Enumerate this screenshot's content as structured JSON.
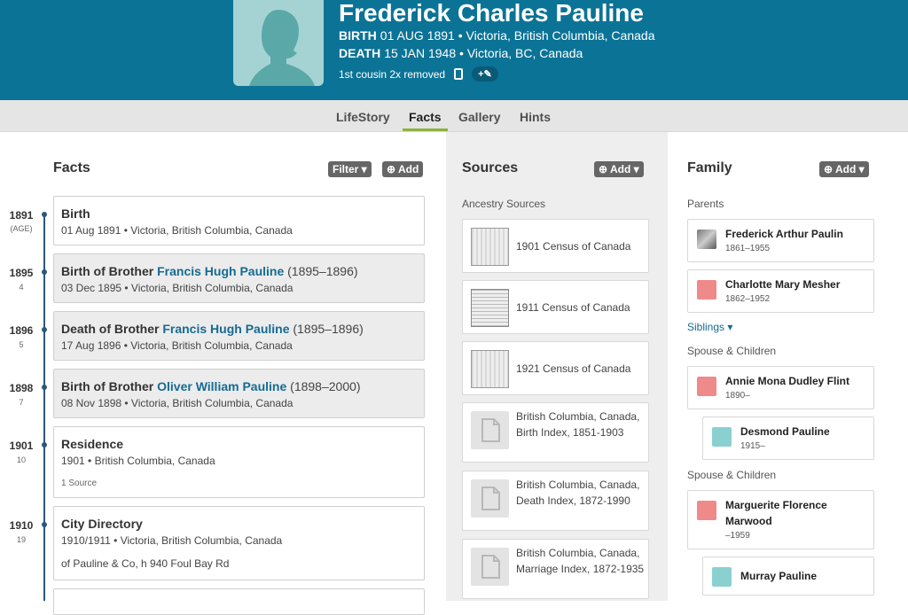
{
  "person": {
    "name": "Frederick Charles Pauline",
    "birth_label": "BIRTH",
    "birth": "01 AUG 1891 • Victoria, British Columbia, Canada",
    "death_label": "DEATH",
    "death": "15 JAN 1948 • Victoria, BC, Canada",
    "relation": "1st cousin 2x removed",
    "tag_button": "+✎"
  },
  "nav": {
    "tabs": [
      "LifeStory",
      "Facts",
      "Gallery",
      "Hints"
    ],
    "active": "Facts"
  },
  "facts": {
    "heading": "Facts",
    "filter_label": "Filter ▾",
    "add_label": "⊕ Add",
    "items": [
      {
        "year": "1891",
        "age": "(AGE)",
        "title": "Birth",
        "link": "",
        "range": "",
        "detail": "01 Aug 1891 • Victoria, British Columbia, Canada"
      },
      {
        "year": "1895",
        "age": "4",
        "title": "Birth of Brother ",
        "link": "Francis Hugh Pauline",
        "range": " (1895–1896)",
        "detail": "03 Dec 1895 • Victoria, British Columbia, Canada"
      },
      {
        "year": "1896",
        "age": "5",
        "title": "Death of Brother ",
        "link": "Francis Hugh Pauline",
        "range": " (1895–1896)",
        "detail": "17 Aug 1896 • Victoria, British Columbia, Canada"
      },
      {
        "year": "1898",
        "age": "7",
        "title": "Birth of Brother ",
        "link": "Oliver William Pauline",
        "range": " (1898–2000)",
        "detail": "08 Nov 1898 • Victoria, British Columbia, Canada"
      },
      {
        "year": "1901",
        "age": "10",
        "title": "Residence",
        "link": "",
        "range": "",
        "detail": "1901 • British Columbia, Canada",
        "extra": "1 Source"
      },
      {
        "year": "1910",
        "age": "19",
        "title": "City Directory",
        "link": "",
        "range": "",
        "detail": "1910/1911 • Victoria, British Columbia, Canada",
        "extra": "of Pauline & Co, h 940 Foul Bay Rd"
      }
    ]
  },
  "sources": {
    "heading": "Sources",
    "add_label": "⊕ Add ▾",
    "subheading": "Ancestry Sources",
    "items": [
      "1901 Census of Canada",
      "1911 Census of Canada",
      "1921 Census of Canada",
      "British Columbia, Canada, Birth Index, 1851-1903",
      "British Columbia, Canada, Death Index, 1872-1990",
      "British Columbia, Canada, Marriage Index, 1872-1935"
    ]
  },
  "family": {
    "heading": "Family",
    "add_label": "⊕ Add ▾",
    "parents_label": "Parents",
    "siblings_label": "Siblings ▾",
    "spouse_label_1": "Spouse & Children",
    "spouse_label_2": "Spouse & Children",
    "parents": [
      {
        "name": "Frederick Arthur Paulin",
        "years": "1861–1955"
      },
      {
        "name": "Charlotte Mary Mesher",
        "years": "1862–1952"
      }
    ],
    "spouse1": {
      "name": "Annie Mona Dudley Flint",
      "years": "1890–"
    },
    "child1": {
      "name": "Desmond Pauline",
      "years": "1915–"
    },
    "spouse2": {
      "name": "Marguerite Florence Marwood",
      "years": "–1959"
    },
    "child2": {
      "name": "Murray Pauline"
    }
  }
}
